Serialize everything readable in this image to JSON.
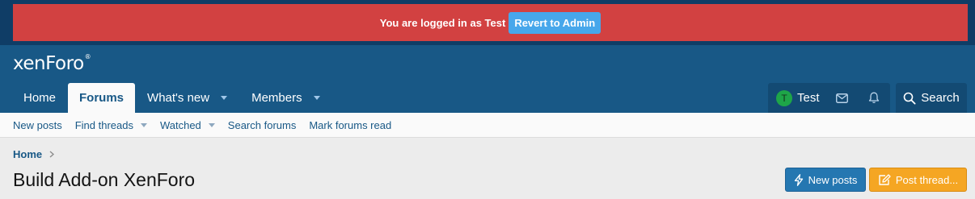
{
  "notice": {
    "text": "You are logged in as Test",
    "button_label": "Revert to Admin"
  },
  "header": {
    "logo_text": "xenForo",
    "logo_mark": "®"
  },
  "nav": {
    "tabs": [
      {
        "label": "Home",
        "active": false,
        "has_menu": false
      },
      {
        "label": "Forums",
        "active": true,
        "has_menu": false
      },
      {
        "label": "What's new",
        "active": false,
        "has_menu": true
      },
      {
        "label": "Members",
        "active": false,
        "has_menu": true
      }
    ],
    "user": {
      "avatar_letter": "T",
      "name": "Test"
    },
    "search_label": "Search"
  },
  "subnav": {
    "items": [
      {
        "label": "New posts",
        "has_menu": false
      },
      {
        "label": "Find threads",
        "has_menu": true
      },
      {
        "label": "Watched",
        "has_menu": true
      },
      {
        "label": "Search forums",
        "has_menu": false
      },
      {
        "label": "Mark forums read",
        "has_menu": false
      }
    ]
  },
  "breadcrumb": {
    "items": [
      "Home"
    ]
  },
  "page": {
    "title": "Build Add-on XenForo",
    "new_posts_label": "New posts",
    "post_thread_label": "Post thread..."
  },
  "colors": {
    "header_bg": "#185886",
    "notice_bg": "#d24141",
    "revert_button_bg": "#47a7eb",
    "primary_button_bg": "#2577b1",
    "cta_button_bg": "#f5a623",
    "avatar_bg": "#1ea548"
  },
  "icons": {
    "mail": "envelope-icon",
    "alerts": "bell-icon",
    "search": "search-icon",
    "new_posts": "bolt-icon",
    "post_thread": "edit-icon"
  }
}
